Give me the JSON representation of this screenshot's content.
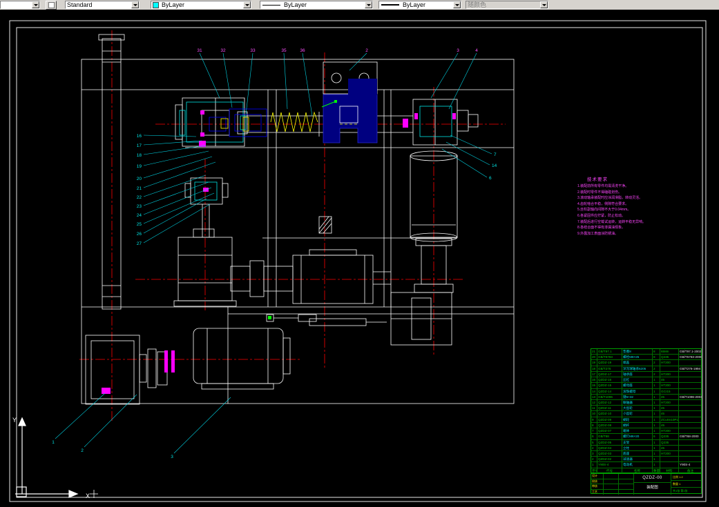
{
  "toolbar": {
    "partial_value": "",
    "style_value": "Standard",
    "color_value": "ByLayer",
    "linetype_value": "ByLayer",
    "lineweight_value": "ByLayer",
    "plotstyle_value": "随颜色"
  },
  "icons": {
    "dropdown_arrow": "▼",
    "color_swatch": "cyan-square"
  },
  "colors": {
    "canvas_bg": "#000000",
    "frame": "#e8e8e8",
    "leader": "#00e5ee",
    "centerline": "#ff0000",
    "accent_magenta": "#ff00ff",
    "accent_yellow": "#ffff00",
    "accent_blue": "#0000ff",
    "table_grid": "#00a000"
  },
  "callouts": {
    "top": [
      "31",
      "32",
      "33",
      "35",
      "36",
      "2",
      "3",
      "4"
    ],
    "left": [
      "16",
      "17",
      "18",
      "19",
      "20",
      "21",
      "22",
      "23",
      "24",
      "25",
      "26",
      "27"
    ],
    "right": [
      "7",
      "14",
      "6"
    ],
    "bottom": [
      "1",
      "2",
      "3"
    ]
  },
  "ucs": {
    "x_label": "X",
    "y_label": "Y"
  },
  "tech": {
    "title": "技术要求",
    "lines": [
      "1.装配前所有零件均需清洗干净。",
      "2.装配时零件不得磕碰划伤。",
      "3.滚动轴承装配时应涂润滑脂，转动灵活。",
      "4.齿轮啮合平稳，侧隙符合要求。",
      "5.丝杠副轴向间隙不大于0.04mm。",
      "6.各紧固件应拧紧，防止松动。",
      "7.装配后进行空载试运转，运转平稳无异响。",
      "8.各结合面不得有渗漏油现象。",
      "9.外露加工表面涂防锈油。"
    ]
  },
  "bom": {
    "header": {
      "num": "序号",
      "code": "代号",
      "name": "名称",
      "qty": "数量",
      "material": "材料",
      "remark": "备注"
    },
    "rows": [
      {
        "num": "21",
        "code": "GB/T97.1",
        "name": "垫圈8",
        "qty": "8",
        "material": "65Mn",
        "std": "GB/T97.1-2002"
      },
      {
        "num": "20",
        "code": "GB/T5783",
        "name": "螺栓M8×25",
        "qty": "8",
        "material": "Q235",
        "std": "GB/T5783-2000"
      },
      {
        "num": "19",
        "code": "QZDZ-19",
        "name": "端盖",
        "qty": "2",
        "material": "HT200",
        "std": ""
      },
      {
        "num": "18",
        "code": "GB/T276",
        "name": "深沟球轴承6205",
        "qty": "2",
        "material": "",
        "std": "GB/T276-1994"
      },
      {
        "num": "17",
        "code": "QZDZ-17",
        "name": "轴承座",
        "qty": "2",
        "material": "HT200",
        "std": ""
      },
      {
        "num": "16",
        "code": "QZDZ-16",
        "name": "丝杠",
        "qty": "1",
        "material": "45",
        "std": ""
      },
      {
        "num": "15",
        "code": "QZDZ-15",
        "name": "螺母座",
        "qty": "1",
        "material": "HT200",
        "std": ""
      },
      {
        "num": "14",
        "code": "QZDZ-14",
        "name": "滚珠螺母",
        "qty": "1",
        "material": "GCr15",
        "std": ""
      },
      {
        "num": "13",
        "code": "GB/T1096",
        "name": "键6×32",
        "qty": "1",
        "material": "45",
        "std": "GB/T1096-2003"
      },
      {
        "num": "12",
        "code": "QZDZ-12",
        "name": "联轴器",
        "qty": "1",
        "material": "HT200",
        "std": ""
      },
      {
        "num": "11",
        "code": "QZDZ-11",
        "name": "大齿轮",
        "qty": "1",
        "material": "45",
        "std": ""
      },
      {
        "num": "10",
        "code": "QZDZ-10",
        "name": "小齿轮",
        "qty": "1",
        "material": "45",
        "std": ""
      },
      {
        "num": "9",
        "code": "QZDZ-09",
        "name": "蜗轮",
        "qty": "1",
        "material": "ZCuSn10P1",
        "std": ""
      },
      {
        "num": "8",
        "code": "QZDZ-08",
        "name": "蜗杆",
        "qty": "1",
        "material": "45",
        "std": ""
      },
      {
        "num": "7",
        "code": "QZDZ-07",
        "name": "箱体",
        "qty": "1",
        "material": "HT200",
        "std": ""
      },
      {
        "num": "6",
        "code": "GB/T68",
        "name": "螺钉M6×20",
        "qty": "6",
        "material": "Q235",
        "std": "GB/T68-2000"
      },
      {
        "num": "5",
        "code": "QZDZ-05",
        "name": "支架",
        "qty": "1",
        "material": "Q235",
        "std": ""
      },
      {
        "num": "4",
        "code": "QZDZ-04",
        "name": "立柱",
        "qty": "1",
        "material": "45",
        "std": ""
      },
      {
        "num": "3",
        "code": "QZDZ-03",
        "name": "底座",
        "qty": "1",
        "material": "HT200",
        "std": ""
      },
      {
        "num": "2",
        "code": "QZDZ-02",
        "name": "减速器",
        "qty": "1",
        "material": "",
        "std": ""
      },
      {
        "num": "1",
        "code": "Y90S-4",
        "name": "电动机",
        "qty": "1",
        "material": "",
        "std": "Y90S-4"
      }
    ]
  },
  "title_block": {
    "code": "QZDZ-00",
    "name": "装配图",
    "left_labels": [
      "设计",
      "校核",
      "审核",
      "工艺"
    ],
    "right_cells": [
      "比例 1:2",
      "数量 1",
      "共1张 第1张"
    ]
  }
}
